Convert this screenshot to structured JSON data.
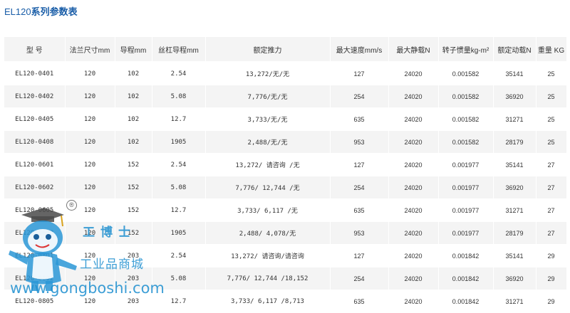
{
  "page": {
    "title_prefix": "EL120",
    "title_suffix": "系列参数表"
  },
  "table": {
    "headers": [
      "型 号",
      "法兰尺寸mm",
      "导程mm",
      "丝杠导程mm",
      "额定推力",
      "最大速度mm/s",
      "最大静载N",
      "转子惯量kg-m²",
      "额定动载N",
      "重量 KG"
    ],
    "rows": [
      [
        "EL120-0401",
        "120",
        "102",
        "2.54",
        "13,272/无/无",
        "127",
        "24020",
        "0.001582",
        "35141",
        "25"
      ],
      [
        "EL120-0402",
        "120",
        "102",
        "5.08",
        "7,776/无/无",
        "254",
        "24020",
        "0.001582",
        "36920",
        "25"
      ],
      [
        "EL120-0405",
        "120",
        "102",
        "12.7",
        "3,733/无/无",
        "635",
        "24020",
        "0.001582",
        "31271",
        "25"
      ],
      [
        "EL120-0408",
        "120",
        "102",
        "1905",
        "2,488/无/无",
        "953",
        "24020",
        "0.001582",
        "28179",
        "25"
      ],
      [
        "EL120-0601",
        "120",
        "152",
        "2.54",
        "13,272/ 请咨询 /无",
        "127",
        "24020",
        "0.001977",
        "35141",
        "27"
      ],
      [
        "EL120-0602",
        "120",
        "152",
        "5.08",
        "7,776/ 12,744 /无",
        "254",
        "24020",
        "0.001977",
        "36920",
        "27"
      ],
      [
        "EL120-0605",
        "120",
        "152",
        "12.7",
        "3,733/ 6,117 /无",
        "635",
        "24020",
        "0.001977",
        "31271",
        "27"
      ],
      [
        "EL120-0608",
        "120",
        "152",
        "1905",
        "2,488/ 4,078/无",
        "953",
        "24020",
        "0.001977",
        "28179",
        "27"
      ],
      [
        "EL120-0801",
        "120",
        "203",
        "2.54",
        "13,272/ 请咨询/请咨询",
        "127",
        "24020",
        "0.001842",
        "35141",
        "29"
      ],
      [
        "EL120-0802",
        "120",
        "203",
        "5.08",
        "7,776/ 12,744 /18,152",
        "254",
        "24020",
        "0.001842",
        "36920",
        "29"
      ],
      [
        "EL120-0805",
        "120",
        "203",
        "12.7",
        "3,733/ 6,117 /8,713",
        "635",
        "24020",
        "0.001842",
        "31271",
        "29"
      ]
    ]
  },
  "watermark": {
    "registered_mark": "®",
    "brand_zh": "工博士",
    "tagline_zh": "工业品商城",
    "url": "www.gongboshi.com"
  }
}
